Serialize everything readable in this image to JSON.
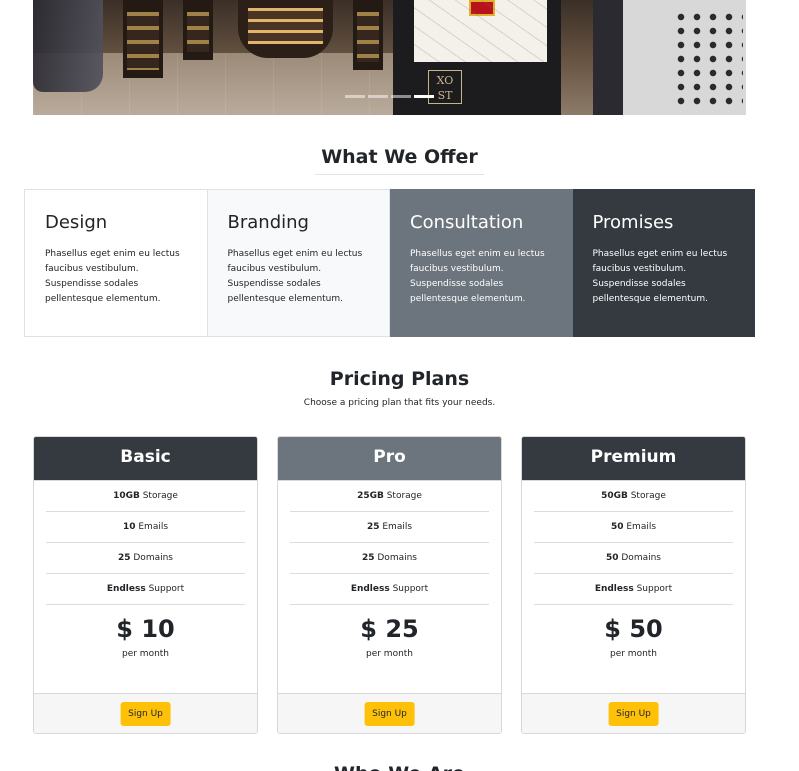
{
  "hero": {
    "logo_text": "XO ST",
    "indicator_count": 4,
    "active_indicator": 4
  },
  "offer": {
    "title": "What We Offer",
    "cards": [
      {
        "title": "Design",
        "text": "Phasellus eget enim eu lectus faucibus vestibulum. Suspendisse sodales pellentesque elementum."
      },
      {
        "title": "Branding",
        "text": "Phasellus eget enim eu lectus faucibus vestibulum. Suspendisse sodales pellentesque elementum."
      },
      {
        "title": "Consultation",
        "text": "Phasellus eget enim eu lectus faucibus vestibulum. Suspendisse sodales pellentesque elementum."
      },
      {
        "title": "Promises",
        "text": "Phasellus eget enim eu lectus faucibus vestibulum. Suspendisse sodales pellentesque elementum."
      }
    ]
  },
  "pricing": {
    "title": "Pricing Plans",
    "subtitle": "Choose a pricing plan that fits your needs.",
    "plans": [
      {
        "name": "Basic",
        "header_color": "#343a40",
        "features": [
          {
            "strong": "10GB",
            "text": " Storage"
          },
          {
            "strong": "10",
            "text": " Emails"
          },
          {
            "strong": "25",
            "text": " Domains"
          },
          {
            "strong": "Endless",
            "text": " Support"
          }
        ],
        "price": "$ 10",
        "period": "per month",
        "button": "Sign Up"
      },
      {
        "name": "Pro",
        "header_color": "#6c757d",
        "features": [
          {
            "strong": "25GB",
            "text": " Storage"
          },
          {
            "strong": "25",
            "text": " Emails"
          },
          {
            "strong": "25",
            "text": " Domains"
          },
          {
            "strong": "Endless",
            "text": " Support"
          }
        ],
        "price": "$ 25",
        "period": "per month",
        "button": "Sign Up"
      },
      {
        "name": "Premium",
        "header_color": "#343a40",
        "features": [
          {
            "strong": "50GB",
            "text": " Storage"
          },
          {
            "strong": "50",
            "text": " Emails"
          },
          {
            "strong": "50",
            "text": " Domains"
          },
          {
            "strong": "Endless",
            "text": " Support"
          }
        ],
        "price": "$ 50",
        "period": "per month",
        "button": "Sign Up"
      }
    ]
  },
  "next_section": {
    "title": "Who We Are"
  },
  "colors": {
    "accent": "#ffc107",
    "dark": "#343a40",
    "secondary": "#6c757d",
    "light": "#f8f9fa"
  }
}
